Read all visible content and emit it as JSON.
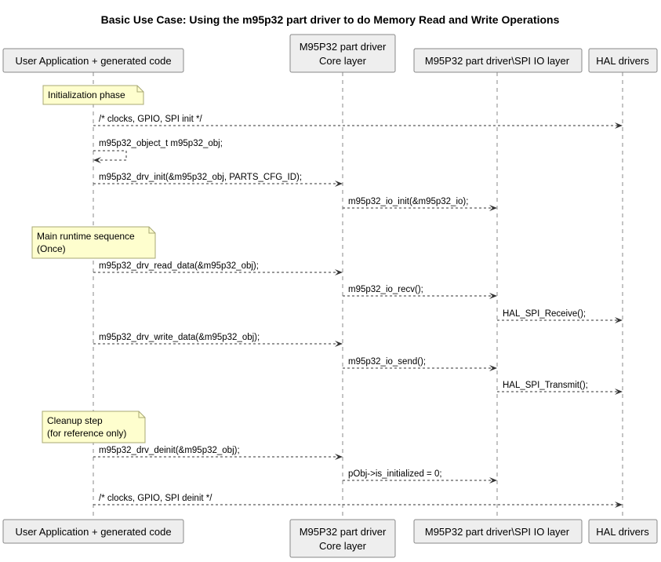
{
  "title": "Basic Use Case: Using the m95p32 part driver to do Memory Read and Write Operations",
  "participants": [
    {
      "id": "app",
      "lines": [
        "User Application + generated code"
      ]
    },
    {
      "id": "core",
      "lines": [
        "M95P32 part driver",
        "Core layer"
      ]
    },
    {
      "id": "io",
      "lines": [
        "M95P32 part driver\\SPI IO layer"
      ]
    },
    {
      "id": "hal",
      "lines": [
        "HAL drivers"
      ]
    }
  ],
  "events": [
    {
      "type": "note",
      "participant": "app",
      "lines": [
        "Initialization phase"
      ]
    },
    {
      "type": "message",
      "from": "app",
      "to": "hal",
      "label": "/* clocks, GPIO, SPI init */"
    },
    {
      "type": "self",
      "participant": "app",
      "label": "m95p32_object_t m95p32_obj;"
    },
    {
      "type": "message",
      "from": "app",
      "to": "core",
      "label": "m95p32_drv_init(&m95p32_obj, PARTS_CFG_ID);"
    },
    {
      "type": "message",
      "from": "core",
      "to": "io",
      "label": "m95p32_io_init(&m95p32_io);"
    },
    {
      "type": "note",
      "participant": "app",
      "lines": [
        "Main runtime sequence",
        "(Once)"
      ]
    },
    {
      "type": "message",
      "from": "app",
      "to": "core",
      "label": "m95p32_drv_read_data(&m95p32_obj);"
    },
    {
      "type": "message",
      "from": "core",
      "to": "io",
      "label": "m95p32_io_recv();"
    },
    {
      "type": "message",
      "from": "io",
      "to": "hal",
      "label": "HAL_SPI_Receive();"
    },
    {
      "type": "message",
      "from": "app",
      "to": "core",
      "label": "m95p32_drv_write_data(&m95p32_obj);"
    },
    {
      "type": "message",
      "from": "core",
      "to": "io",
      "label": "m95p32_io_send();"
    },
    {
      "type": "message",
      "from": "io",
      "to": "hal",
      "label": "HAL_SPI_Transmit();"
    },
    {
      "type": "note",
      "participant": "app",
      "lines": [
        "Cleanup step",
        "(for reference only)"
      ]
    },
    {
      "type": "message",
      "from": "app",
      "to": "core",
      "label": "m95p32_drv_deinit(&m95p32_obj);"
    },
    {
      "type": "message",
      "from": "core",
      "to": "io",
      "label": "pObj->is_initialized = 0;"
    },
    {
      "type": "message",
      "from": "app",
      "to": "hal",
      "label": "/* clocks, GPIO, SPI deinit */"
    }
  ]
}
